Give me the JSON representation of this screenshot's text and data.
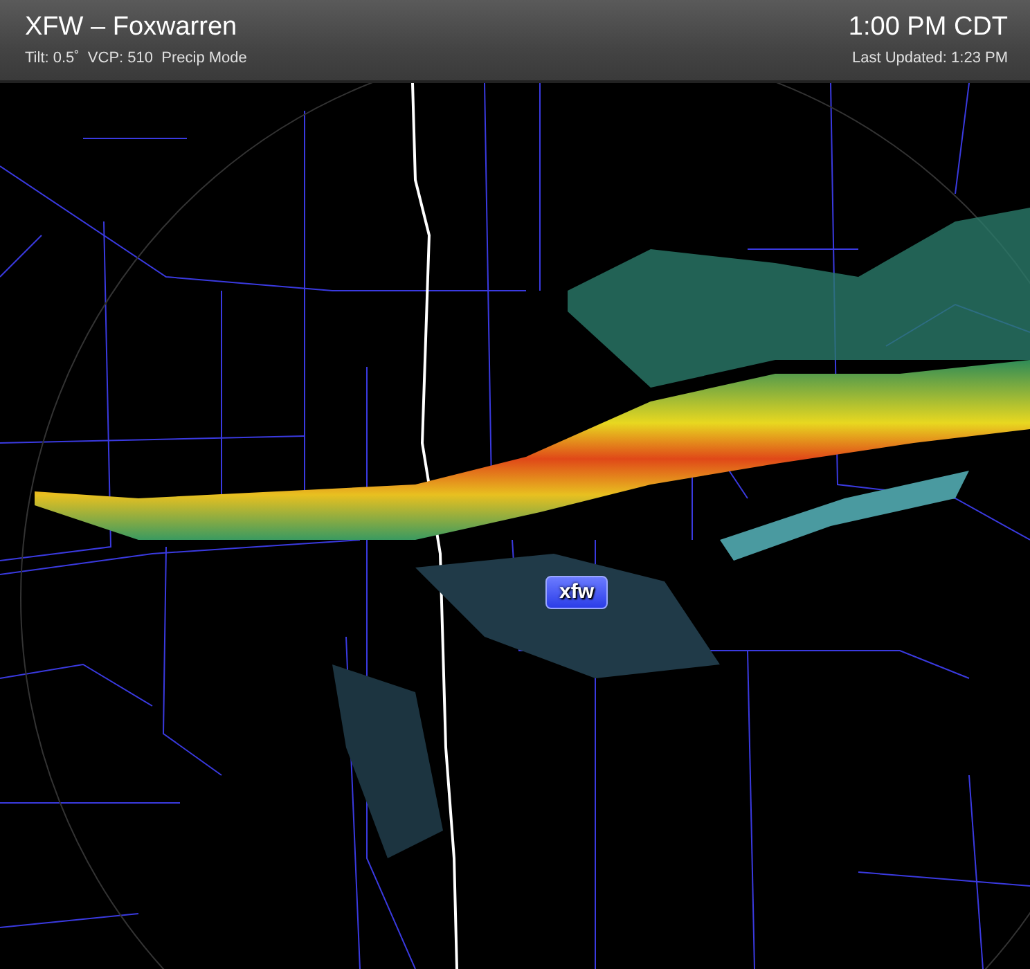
{
  "header": {
    "title": "XFW – Foxwarren",
    "time": "1:00 PM CDT",
    "scan_info": "Tilt: 0.5˚  VCP: 510  Precip Mode",
    "last_updated": "Last Updated: 1:23 PM"
  },
  "map": {
    "station_label": "xfw"
  }
}
